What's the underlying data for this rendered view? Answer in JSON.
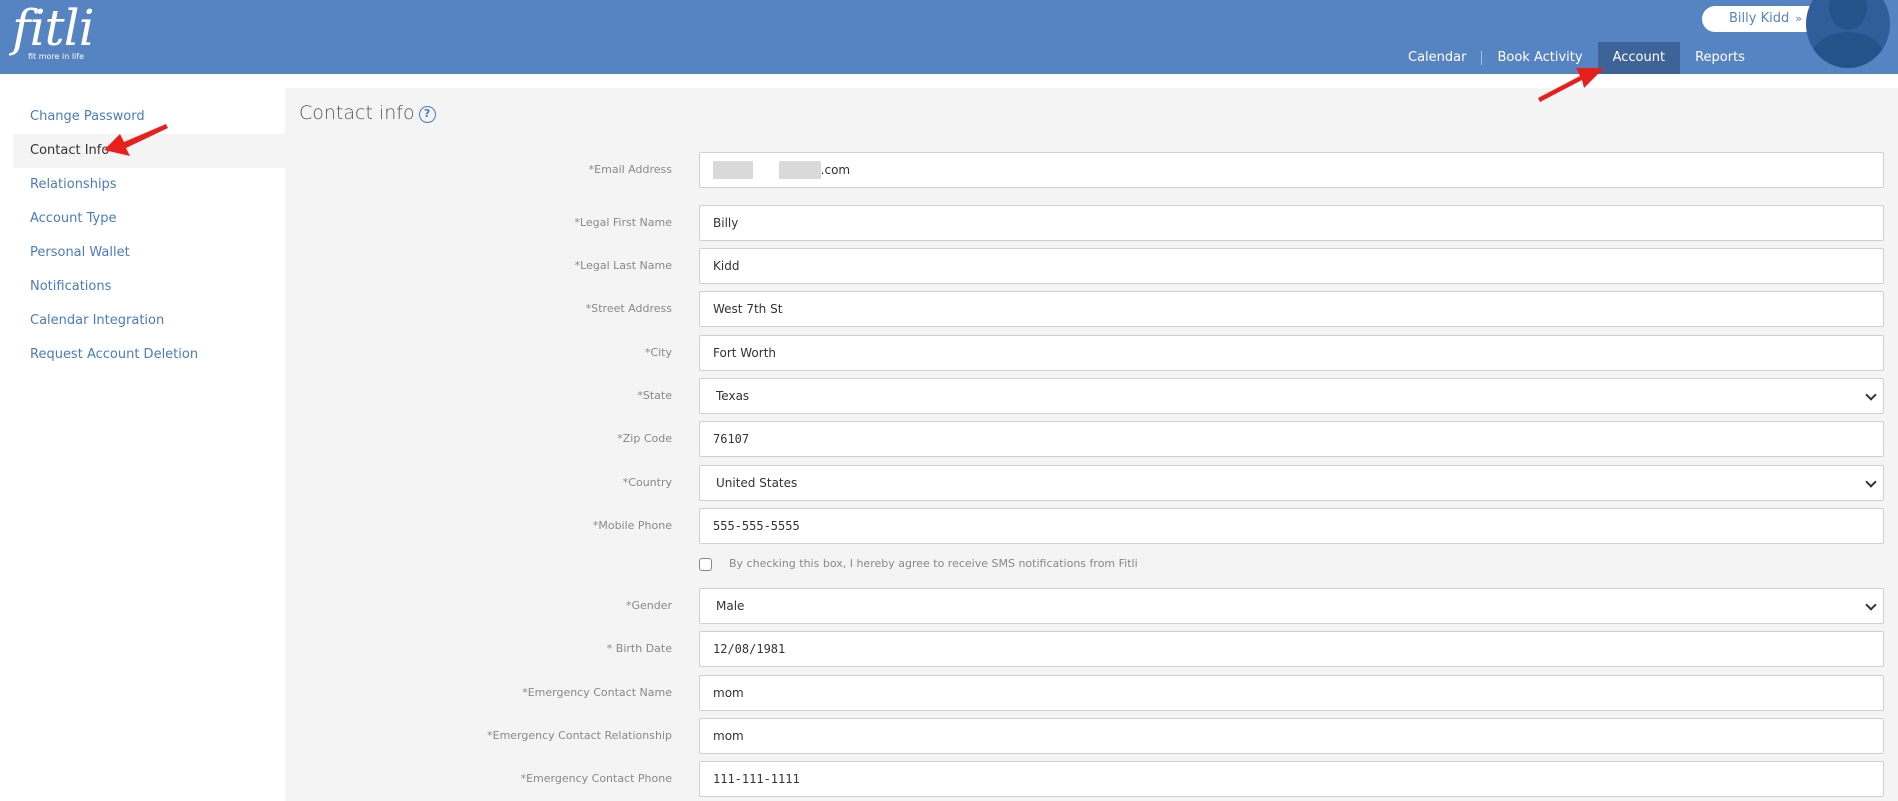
{
  "brand": {
    "name": "fitli",
    "tagline": "fit more in life"
  },
  "user": {
    "name": "Billy Kidd"
  },
  "nav": [
    {
      "label": "Calendar"
    },
    {
      "label": "Book Activity"
    },
    {
      "label": "Account"
    },
    {
      "label": "Reports"
    }
  ],
  "sidebar": [
    {
      "label": "Change Password"
    },
    {
      "label": "Contact Info"
    },
    {
      "label": "Relationships"
    },
    {
      "label": "Account Type"
    },
    {
      "label": "Personal Wallet"
    },
    {
      "label": "Notifications"
    },
    {
      "label": "Calendar Integration"
    },
    {
      "label": "Request Account Deletion"
    }
  ],
  "page": {
    "title": "Contact info"
  },
  "form": {
    "email": {
      "label": "*Email Address",
      "suffix": ".com"
    },
    "first_name": {
      "label": "*Legal First Name",
      "value": "Billy"
    },
    "last_name": {
      "label": "*Legal Last Name",
      "value": "Kidd"
    },
    "street": {
      "label": "*Street Address",
      "value": "West 7th St"
    },
    "city": {
      "label": "*City",
      "value": "Fort Worth"
    },
    "state": {
      "label": "*State",
      "value": "Texas"
    },
    "zip": {
      "label": "*Zip Code",
      "value": "76107"
    },
    "country": {
      "label": "*Country",
      "value": "United States"
    },
    "mobile": {
      "label": "*Mobile Phone",
      "value": "555-555-5555"
    },
    "sms_consent": {
      "label": "By checking this box, I hereby agree to receive SMS notifications from Fitli"
    },
    "gender": {
      "label": "*Gender",
      "value": "Male"
    },
    "birth_date": {
      "label": "* Birth Date",
      "value": "12/08/1981"
    },
    "ec_name": {
      "label": "*Emergency Contact Name",
      "value": "mom"
    },
    "ec_relationship": {
      "label": "*Emergency Contact Relationship",
      "value": "mom"
    },
    "ec_phone": {
      "label": "*Emergency Contact Phone",
      "value": "111-111-1111"
    }
  },
  "colors": {
    "header": "#5683c2",
    "nav_active": "#3e6399",
    "link": "#4a7bbf",
    "panel": "#f4f4f4",
    "annotation": "#e8201c"
  }
}
